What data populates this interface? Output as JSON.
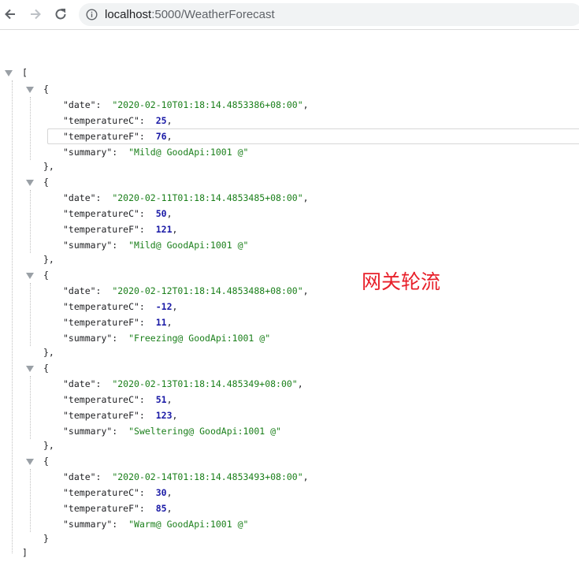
{
  "browser": {
    "url_host": "localhost",
    "url_rest": ":5000/WeatherForecast"
  },
  "json_viewer": {
    "open_bracket": "[",
    "close_bracket": "]",
    "records": [
      {
        "date": "\"2020-02-10T01:18:14.4853386+08:00\"",
        "temperatureC": "25",
        "temperatureF": "76",
        "summary": "\"Mild@ GoodApi:1001 @\"",
        "close": "},"
      },
      {
        "date": "\"2020-02-11T01:18:14.4853485+08:00\"",
        "temperatureC": "50",
        "temperatureF": "121",
        "summary": "\"Mild@ GoodApi:1001 @\"",
        "close": "},"
      },
      {
        "date": "\"2020-02-12T01:18:14.4853488+08:00\"",
        "temperatureC": "-12",
        "temperatureF": "11",
        "summary": "\"Freezing@ GoodApi:1001 @\"",
        "close": "},"
      },
      {
        "date": "\"2020-02-13T01:18:14.485349+08:00\"",
        "temperatureC": "51",
        "temperatureF": "123",
        "summary": "\"Sweltering@ GoodApi:1001 @\"",
        "close": "},"
      },
      {
        "date": "\"2020-02-14T01:18:14.4853493+08:00\"",
        "temperatureC": "30",
        "temperatureF": "85",
        "summary": "\"Warm@ GoodApi:1001 @\"",
        "close": "}"
      }
    ],
    "keys": {
      "date": "\"date\":",
      "temperatureC": "\"temperatureC\":",
      "temperatureF": "\"temperatureF\":",
      "summary": "\"summary\":"
    }
  },
  "overlay_text": "网关轮流",
  "colors": {
    "string": "#1a7f1a",
    "number": "#1a1aa6",
    "overlay": "#e8202a"
  }
}
